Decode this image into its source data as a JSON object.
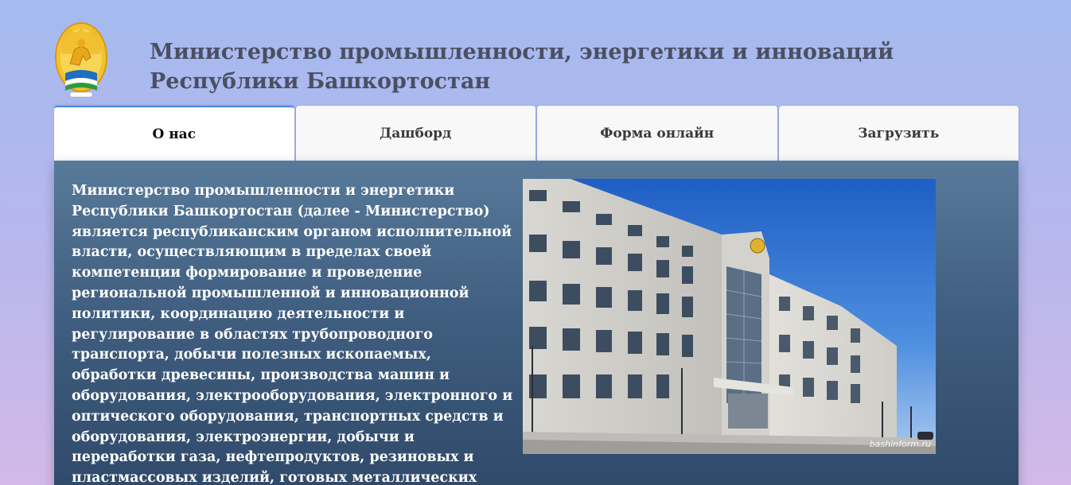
{
  "header": {
    "logo_icon": "bashkortostan-emblem-icon",
    "title_lines": [
      "Министерство промышленности, энергетики и инноваций",
      "Республики Башкортостан"
    ]
  },
  "tabs": [
    {
      "label": "О нас",
      "active": true
    },
    {
      "label": "Дашборд",
      "active": false
    },
    {
      "label": "Форма онлайн",
      "active": false
    },
    {
      "label": "Загрузить",
      "active": false
    }
  ],
  "about": {
    "text_lines": [
      "Министерство промышленности и энергетики",
      "Республики Башкортостан (далее - Министерство)",
      "является республиканским органом исполнительной",
      "власти, осуществляющим в пределах своей",
      "компетенции формирование и проведение",
      "региональной промышленной и инновационной",
      "политики, координацию деятельности и",
      "регулирование в областях трубопроводного",
      "транспорта, добычи полезных ископаемых,",
      "обработки древесины, производства машин и",
      "оборудования, электрооборудования, электронного и",
      "оптического оборудования, транспортных средств и",
      "оборудования, электроэнергии, добычи и",
      "переработки газа, нефтепродуктов, резиновых и",
      "пластмассовых изделий, готовых металлических"
    ],
    "image_watermark": "bashinform.ru",
    "image_icon": "government-building-photo"
  },
  "colors": {
    "background_top": "#a4baf0",
    "background_bottom": "#d2b9e8",
    "title": "#4a4f62",
    "active_tab_accent": "#4a86d8",
    "panel_top": "#587a9a",
    "panel_bottom": "#2e4868"
  }
}
